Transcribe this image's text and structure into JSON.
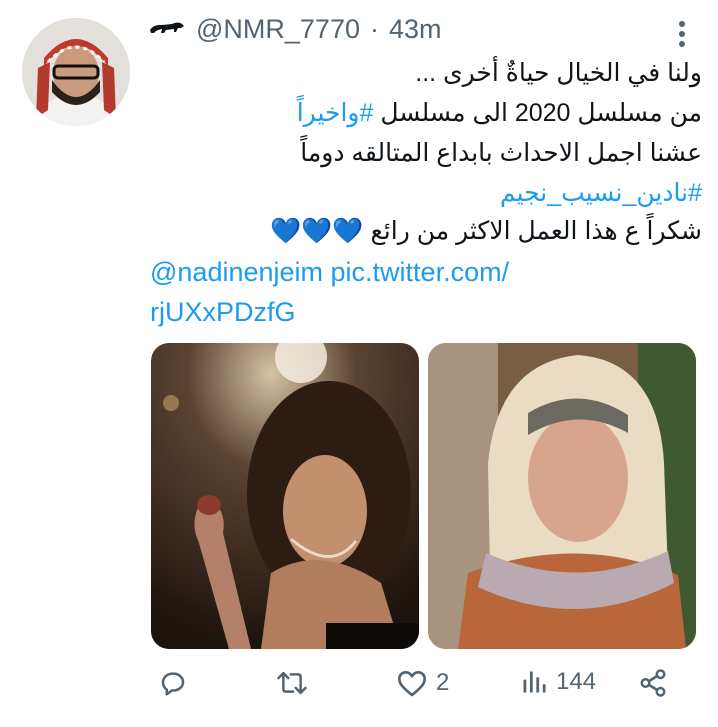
{
  "tweet": {
    "handle": "@NMR_7770",
    "separator": "·",
    "time": "43m",
    "lines": [
      "ولنا في الخيال حياةٌ أخرى ...",
      "من مسلسل 2020 الى مسلسل",
      "#واخيراً",
      "عشنا اجمل الاحداث بابداع المتالقه دوماً",
      "#نادين_نسيب_نجيم",
      "شكراً ع هذا العمل الاكثر من رائع",
      "💙💙💙"
    ],
    "mention": "@nadinenjeim",
    "link_part1": "pic.twitter.com/",
    "link_part2": "rjUXxPDzfG"
  },
  "actions": {
    "reply_count": "",
    "retweet_count": "",
    "like_count": "2",
    "views_count": "144"
  },
  "colors": {
    "link": "#1d9bf0",
    "muted": "#536471",
    "heart": "#1d9bf0"
  },
  "icons": [
    "panther-icon",
    "more-vertical-icon",
    "reply-icon",
    "retweet-icon",
    "heart-icon",
    "views-icon",
    "share-icon"
  ]
}
